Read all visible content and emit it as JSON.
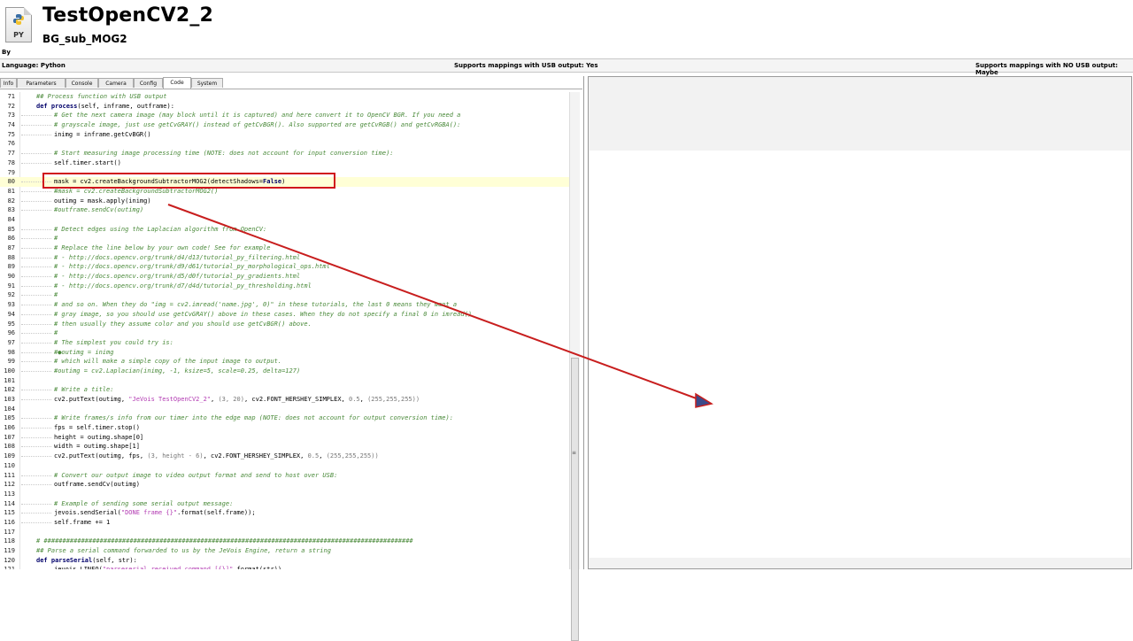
{
  "header": {
    "title": "TestOpenCV2_2",
    "subtitle": "BG_sub_MOG2",
    "by": "By",
    "icon_text": "PY"
  },
  "infobar": {
    "language": "Language: Python",
    "usb_yes": "Supports mappings with USB output: Yes",
    "usb_no": "Supports mappings with NO USB output: Maybe"
  },
  "tabs": [
    "Info",
    "Parameters",
    "Console",
    "Camera",
    "Config",
    "Code",
    "System"
  ],
  "active_tab": "Code",
  "colors": {
    "highlight_box": "#d0141c",
    "arrow": "#c81e1e",
    "comment": "#4a8a3a",
    "keyword": "#00006a",
    "string": "#b23ab2",
    "current_line": "#ffffd6"
  },
  "code": {
    "highlight_line": 80,
    "lines": [
      {
        "n": "71",
        "indent": 0,
        "parts": [
          {
            "t": "## Process function with USB output",
            "c": "c"
          }
        ]
      },
      {
        "n": "72",
        "indent": 0,
        "parts": [
          {
            "t": "def ",
            "c": "k"
          },
          {
            "t": "process",
            "c": "k"
          },
          {
            "t": "(self, inframe, outframe):",
            "c": ""
          }
        ]
      },
      {
        "n": "73",
        "indent": 1,
        "parts": [
          {
            "t": "# Get the next camera image (may block until it is captured) and here convert it to OpenCV BGR. If you need a",
            "c": "c"
          }
        ]
      },
      {
        "n": "74",
        "indent": 1,
        "parts": [
          {
            "t": "# grayscale image, just use getCvGRAY() instead of getCvBGR(). Also supported are getCvRGB() and getCvRGBA():",
            "c": "c"
          }
        ]
      },
      {
        "n": "75",
        "indent": 1,
        "parts": [
          {
            "t": "inimg = inframe.getCvBGR()",
            "c": ""
          }
        ]
      },
      {
        "n": "76",
        "indent": 0,
        "parts": []
      },
      {
        "n": "77",
        "indent": 1,
        "parts": [
          {
            "t": "# Start measuring image processing time (NOTE: does not account for input conversion time):",
            "c": "c"
          }
        ]
      },
      {
        "n": "78",
        "indent": 1,
        "parts": [
          {
            "t": "self.timer.start()",
            "c": ""
          }
        ]
      },
      {
        "n": "79",
        "indent": 0,
        "parts": []
      },
      {
        "n": "80",
        "indent": 1,
        "parts": [
          {
            "t": "mask = cv2.createBackgroundSubtractorMOG2(detectShadows=",
            "c": ""
          },
          {
            "t": "False",
            "c": "k"
          },
          {
            "t": ")",
            "c": ""
          }
        ]
      },
      {
        "n": "81",
        "indent": 1,
        "parts": [
          {
            "t": "#mask = cv2.createBackgroundSubtractorMOG2()",
            "c": "c"
          }
        ]
      },
      {
        "n": "82",
        "indent": 1,
        "parts": [
          {
            "t": "outimg = mask.apply(inimg)",
            "c": ""
          }
        ]
      },
      {
        "n": "83",
        "indent": 1,
        "parts": [
          {
            "t": "#outframe.sendCv(outimg)",
            "c": "c"
          }
        ]
      },
      {
        "n": "84",
        "indent": 0,
        "parts": []
      },
      {
        "n": "85",
        "indent": 1,
        "parts": [
          {
            "t": "# Detect edges using the Laplacian algorithm from OpenCV:",
            "c": "c"
          }
        ]
      },
      {
        "n": "86",
        "indent": 1,
        "parts": [
          {
            "t": "#",
            "c": "c"
          }
        ]
      },
      {
        "n": "87",
        "indent": 1,
        "parts": [
          {
            "t": "# Replace the line below by your own code! See for example",
            "c": "c"
          }
        ]
      },
      {
        "n": "88",
        "indent": 1,
        "parts": [
          {
            "t": "# - http://docs.opencv.org/trunk/d4/d13/tutorial_py_filtering.html",
            "c": "c"
          }
        ]
      },
      {
        "n": "89",
        "indent": 1,
        "parts": [
          {
            "t": "# - http://docs.opencv.org/trunk/d9/d61/tutorial_py_morphological_ops.html",
            "c": "c"
          }
        ]
      },
      {
        "n": "90",
        "indent": 1,
        "parts": [
          {
            "t": "# - http://docs.opencv.org/trunk/d5/d0f/tutorial_py_gradients.html",
            "c": "c"
          }
        ]
      },
      {
        "n": "91",
        "indent": 1,
        "parts": [
          {
            "t": "# - http://docs.opencv.org/trunk/d7/d4d/tutorial_py_thresholding.html",
            "c": "c"
          }
        ]
      },
      {
        "n": "92",
        "indent": 1,
        "parts": [
          {
            "t": "#",
            "c": "c"
          }
        ]
      },
      {
        "n": "93",
        "indent": 1,
        "parts": [
          {
            "t": "# and so on. When they do \"img = cv2.imread('name.jpg', 0)\" in these tutorials, the last 0 means they want a",
            "c": "c"
          }
        ]
      },
      {
        "n": "94",
        "indent": 1,
        "parts": [
          {
            "t": "# gray image, so you should use getCvGRAY() above in these cases. When they do not specify a final 0 in imread()",
            "c": "c"
          }
        ]
      },
      {
        "n": "95",
        "indent": 1,
        "parts": [
          {
            "t": "# then usually they assume color and you should use getCvBGR() above.",
            "c": "c"
          }
        ]
      },
      {
        "n": "96",
        "indent": 1,
        "parts": [
          {
            "t": "#",
            "c": "c"
          }
        ]
      },
      {
        "n": "97",
        "indent": 1,
        "parts": [
          {
            "t": "# The simplest you could try is:",
            "c": "c"
          }
        ]
      },
      {
        "n": "98",
        "indent": 1,
        "parts": [
          {
            "t": "#●outimg = inimg",
            "c": "c"
          }
        ]
      },
      {
        "n": "99",
        "indent": 1,
        "parts": [
          {
            "t": "# which will make a simple copy of the input image to output.",
            "c": "c"
          }
        ]
      },
      {
        "n": "100",
        "indent": 1,
        "parts": [
          {
            "t": "#outimg = cv2.Laplacian(inimg, -1, ksize=5, scale=0.25, delta=127)",
            "c": "c"
          }
        ]
      },
      {
        "n": "101",
        "indent": 0,
        "parts": []
      },
      {
        "n": "102",
        "indent": 1,
        "parts": [
          {
            "t": "# Write a title:",
            "c": "c"
          }
        ]
      },
      {
        "n": "103",
        "indent": 1,
        "parts": [
          {
            "t": "cv2.putText(outimg, ",
            "c": ""
          },
          {
            "t": "\"JeVois TestOpenCV2_2\"",
            "c": "s"
          },
          {
            "t": ", ",
            "c": ""
          },
          {
            "t": "(3, 20)",
            "c": "n"
          },
          {
            "t": ", cv2.FONT_HERSHEY_SIMPLEX, ",
            "c": ""
          },
          {
            "t": "0.5",
            "c": "n"
          },
          {
            "t": ", ",
            "c": ""
          },
          {
            "t": "(255,255,255))",
            "c": "n"
          }
        ]
      },
      {
        "n": "104",
        "indent": 0,
        "parts": []
      },
      {
        "n": "105",
        "indent": 1,
        "parts": [
          {
            "t": "# Write frames/s info from our timer into the edge map (NOTE: does not account for output conversion time):",
            "c": "c"
          }
        ]
      },
      {
        "n": "106",
        "indent": 1,
        "parts": [
          {
            "t": "fps = self.timer.stop()",
            "c": ""
          }
        ]
      },
      {
        "n": "107",
        "indent": 1,
        "parts": [
          {
            "t": "height = outimg.shape[0]",
            "c": ""
          }
        ]
      },
      {
        "n": "108",
        "indent": 1,
        "parts": [
          {
            "t": "width = outimg.shape[1]",
            "c": ""
          }
        ]
      },
      {
        "n": "109",
        "indent": 1,
        "parts": [
          {
            "t": "cv2.putText(outimg, fps, ",
            "c": ""
          },
          {
            "t": "(3, height - 6)",
            "c": "n"
          },
          {
            "t": ", cv2.FONT_HERSHEY_SIMPLEX, ",
            "c": ""
          },
          {
            "t": "0.5",
            "c": "n"
          },
          {
            "t": ", ",
            "c": ""
          },
          {
            "t": "(255,255,255))",
            "c": "n"
          }
        ]
      },
      {
        "n": "110",
        "indent": 0,
        "parts": []
      },
      {
        "n": "111",
        "indent": 1,
        "parts": [
          {
            "t": "# Convert our output image to video output format and send to host over USB:",
            "c": "c"
          }
        ]
      },
      {
        "n": "112",
        "indent": 1,
        "parts": [
          {
            "t": "outframe.sendCv(outimg)",
            "c": ""
          }
        ]
      },
      {
        "n": "113",
        "indent": 0,
        "parts": []
      },
      {
        "n": "114",
        "indent": 1,
        "parts": [
          {
            "t": "# Example of sending some serial output message:",
            "c": "c"
          }
        ]
      },
      {
        "n": "115",
        "indent": 1,
        "parts": [
          {
            "t": "jevois.sendSerial(",
            "c": ""
          },
          {
            "t": "\"DONE frame {}\"",
            "c": "s"
          },
          {
            "t": ".format(self.frame));",
            "c": ""
          }
        ]
      },
      {
        "n": "116",
        "indent": 1,
        "parts": [
          {
            "t": "self.frame += 1",
            "c": ""
          }
        ]
      },
      {
        "n": "117",
        "indent": 0,
        "parts": []
      },
      {
        "n": "118",
        "indent": 0,
        "parts": [
          {
            "t": "# ###################################################################################################",
            "c": "c"
          }
        ]
      },
      {
        "n": "119",
        "indent": 0,
        "parts": [
          {
            "t": "## Parse a serial command forwarded to us by the JeVois Engine, return a string",
            "c": "c"
          }
        ]
      },
      {
        "n": "120",
        "indent": 0,
        "parts": [
          {
            "t": "def ",
            "c": "k"
          },
          {
            "t": "parseSerial",
            "c": "k"
          },
          {
            "t": "(self, str):",
            "c": ""
          }
        ]
      },
      {
        "n": "121",
        "indent": 1,
        "parts": [
          {
            "t": "jevois.LINFO(",
            "c": ""
          },
          {
            "t": "\"parseserial received command [{}]\"",
            "c": "s"
          },
          {
            "t": ".format(str))",
            "c": ""
          }
        ]
      }
    ]
  }
}
